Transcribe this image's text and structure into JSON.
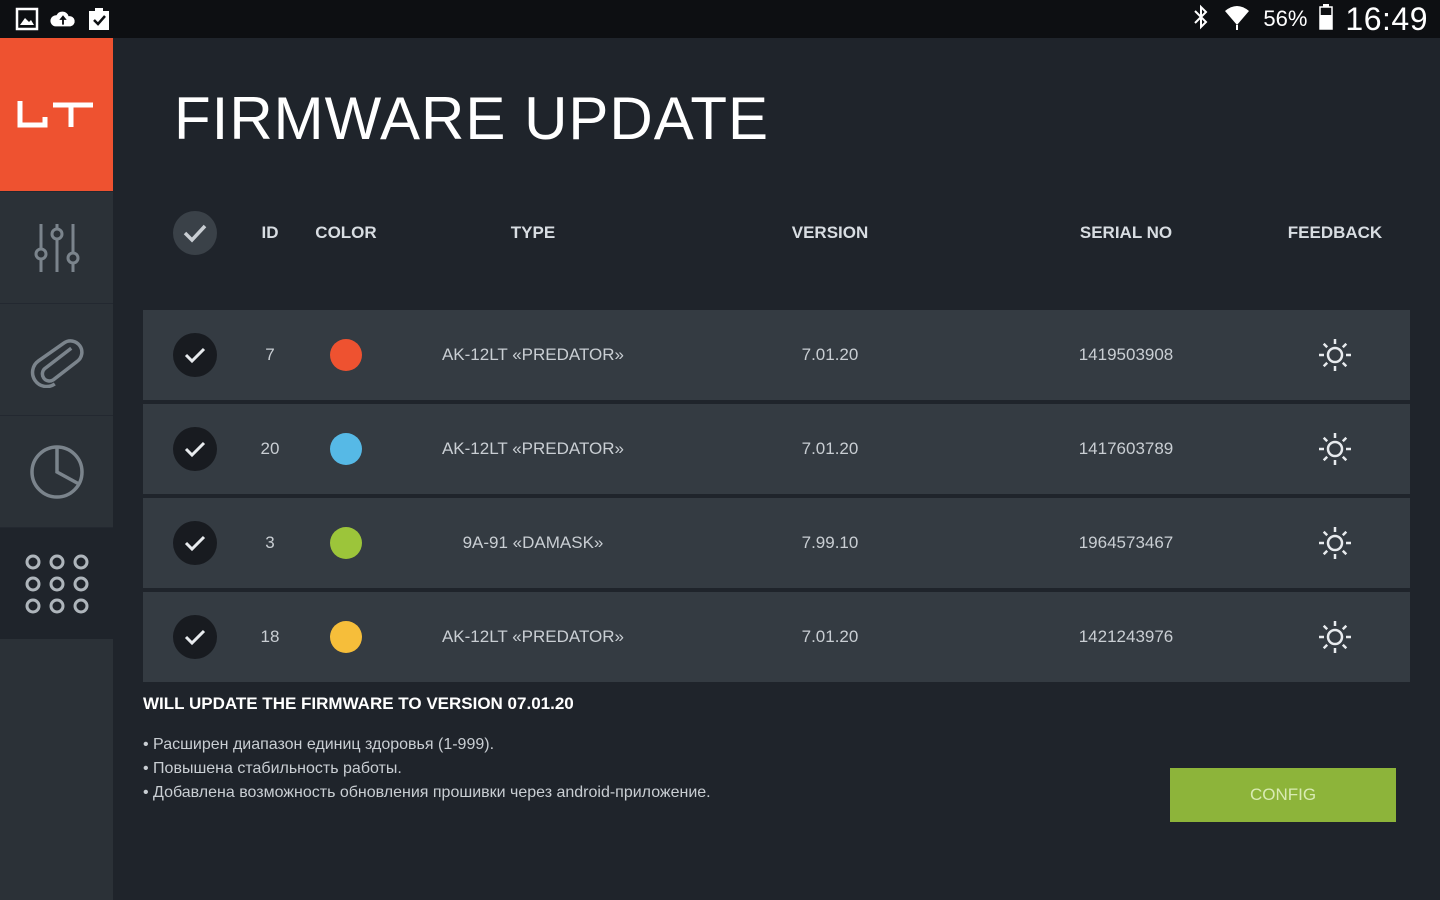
{
  "status_bar": {
    "left_icons": [
      "gallery-icon",
      "cloud-upload-icon",
      "clipboard-check-icon"
    ],
    "right_icons": [
      "bluetooth-icon",
      "wifi-icon",
      "battery-icon"
    ],
    "battery": "56%",
    "time": "16:49"
  },
  "sidebar": {
    "logo": "LT",
    "items": [
      {
        "icon": "sliders-icon",
        "active": false
      },
      {
        "icon": "paperclip-icon",
        "active": false
      },
      {
        "icon": "pie-chart-icon",
        "active": false
      },
      {
        "icon": "grid-dots-icon",
        "active": true
      }
    ]
  },
  "page": {
    "title": "FIRMWARE UPDATE"
  },
  "table": {
    "headers": {
      "id": "ID",
      "color": "COLOR",
      "type": "TYPE",
      "version": "VERSION",
      "serial": "SERIAL NO",
      "feedback": "FEEDBACK"
    },
    "rows": [
      {
        "id": "7",
        "color": "#ee5230",
        "type": "AK-12LT «PREDATOR»",
        "version": "7.01.20",
        "serial": "1419503908"
      },
      {
        "id": "20",
        "color": "#56b9e6",
        "type": "AK-12LT «PREDATOR»",
        "version": "7.01.20",
        "serial": "1417603789"
      },
      {
        "id": "3",
        "color": "#9cc53a",
        "type": "9A-91 «DAMASK»",
        "version": "7.99.10",
        "serial": "1964573467"
      },
      {
        "id": "18",
        "color": "#f6be3a",
        "type": "AK-12LT «PREDATOR»",
        "version": "7.01.20",
        "serial": "1421243976"
      }
    ]
  },
  "update": {
    "title": "WILL UPDATE THE FIRMWARE TO VERSION 07.01.20",
    "notes": [
      "• Расширен диапазон единиц здоровья (1-999).",
      "• Повышена стабильность работы.",
      "• Добавлена возможность обновления прошивки через android-приложение."
    ]
  },
  "config_button": {
    "label": "CONFIG"
  },
  "colors": {
    "accent": "#ee5230",
    "button": "#8db43a",
    "background": "#1f242b",
    "row": "#343b42"
  }
}
